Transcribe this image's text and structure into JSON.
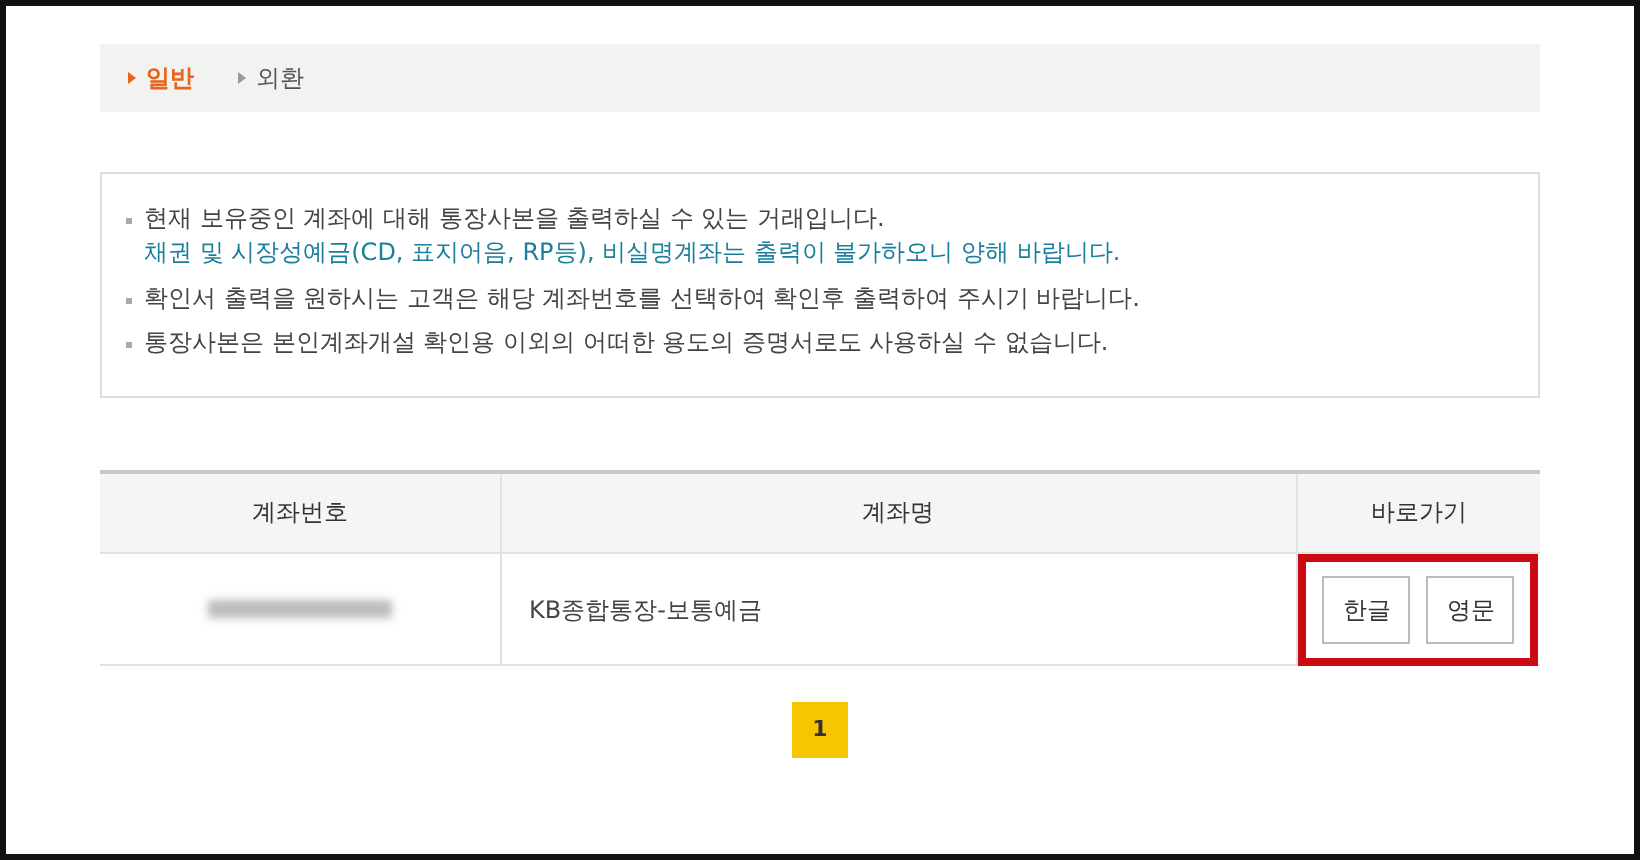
{
  "tabs": [
    {
      "label": "일반",
      "selected": true
    },
    {
      "label": "외환",
      "selected": false
    }
  ],
  "notices": [
    {
      "text": "현재 보유중인 계좌에 대해 통장사본을 출력하실 수 있는 거래입니다.",
      "sub": "채권 및 시장성예금(CD, 표지어음, RP등), 비실명계좌는 출력이 불가하오니 양해 바랍니다."
    },
    {
      "text": "확인서 출력을 원하시는 고객은 해당 계좌번호를 선택하여 확인후 출력하여 주시기 바랍니다."
    },
    {
      "text": "통장사본은 본인계좌개설 확인용 이외의 어떠한 용도의 증명서로도 사용하실 수 없습니다."
    }
  ],
  "table": {
    "columns": [
      "계좌번호",
      "계좌명",
      "바로가기"
    ],
    "rows": [
      {
        "account_number_redacted": true,
        "account_name": "KB종합통장-보통예금",
        "buttons": [
          "한글",
          "영문"
        ],
        "buttons_highlighted": true
      }
    ]
  },
  "pagination": [
    {
      "label": "1",
      "selected": true
    }
  ]
}
